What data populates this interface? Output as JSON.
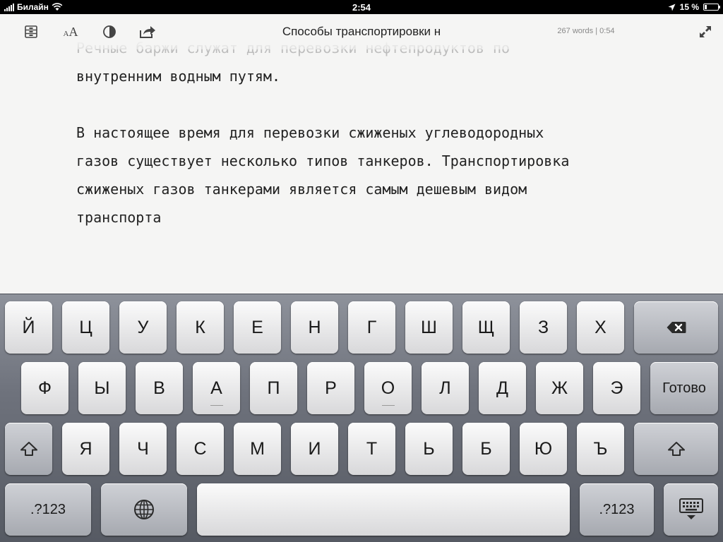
{
  "status": {
    "carrier": "Билайн",
    "time": "2:54",
    "battery": "15 %",
    "battery_fraction": 0.15
  },
  "toolbar": {
    "title": "Способы транспортировки н",
    "stats": "267 words | 0:54",
    "icons": [
      "library-icon",
      "font-size-icon",
      "contrast-icon",
      "share-icon",
      "fullscreen-icon"
    ],
    "font_icon_label": "AA"
  },
  "document": {
    "paragraphs": [
      "Речные баржи служат для перевозки нефтепродуктов по",
      "внутренним водным путям.",
      "",
      "В настоящее время для перевозки сжиженых углеводородных",
      "газов существует несколько типов танкеров. Транспортировка",
      "сжиженых газов танкерами является самым дешевым видом",
      "транспорта"
    ]
  },
  "keyboard": {
    "row1": [
      "Й",
      "Ц",
      "У",
      "К",
      "Е",
      "Н",
      "Г",
      "Ш",
      "Щ",
      "З",
      "Х"
    ],
    "row2": [
      "Ф",
      "Ы",
      "В",
      "А",
      "П",
      "Р",
      "О",
      "Л",
      "Д",
      "Ж",
      "Э"
    ],
    "row3": [
      "Я",
      "Ч",
      "С",
      "М",
      "И",
      "Т",
      "Ь",
      "Б",
      "Ю",
      "Ъ"
    ],
    "done": "Готово",
    "numbers": ".?123",
    "backspace_icon": "backspace-icon",
    "shift_icon": "shift-icon",
    "globe_icon": "globe-icon",
    "hide_keyboard_icon": "hide-keyboard-icon"
  }
}
